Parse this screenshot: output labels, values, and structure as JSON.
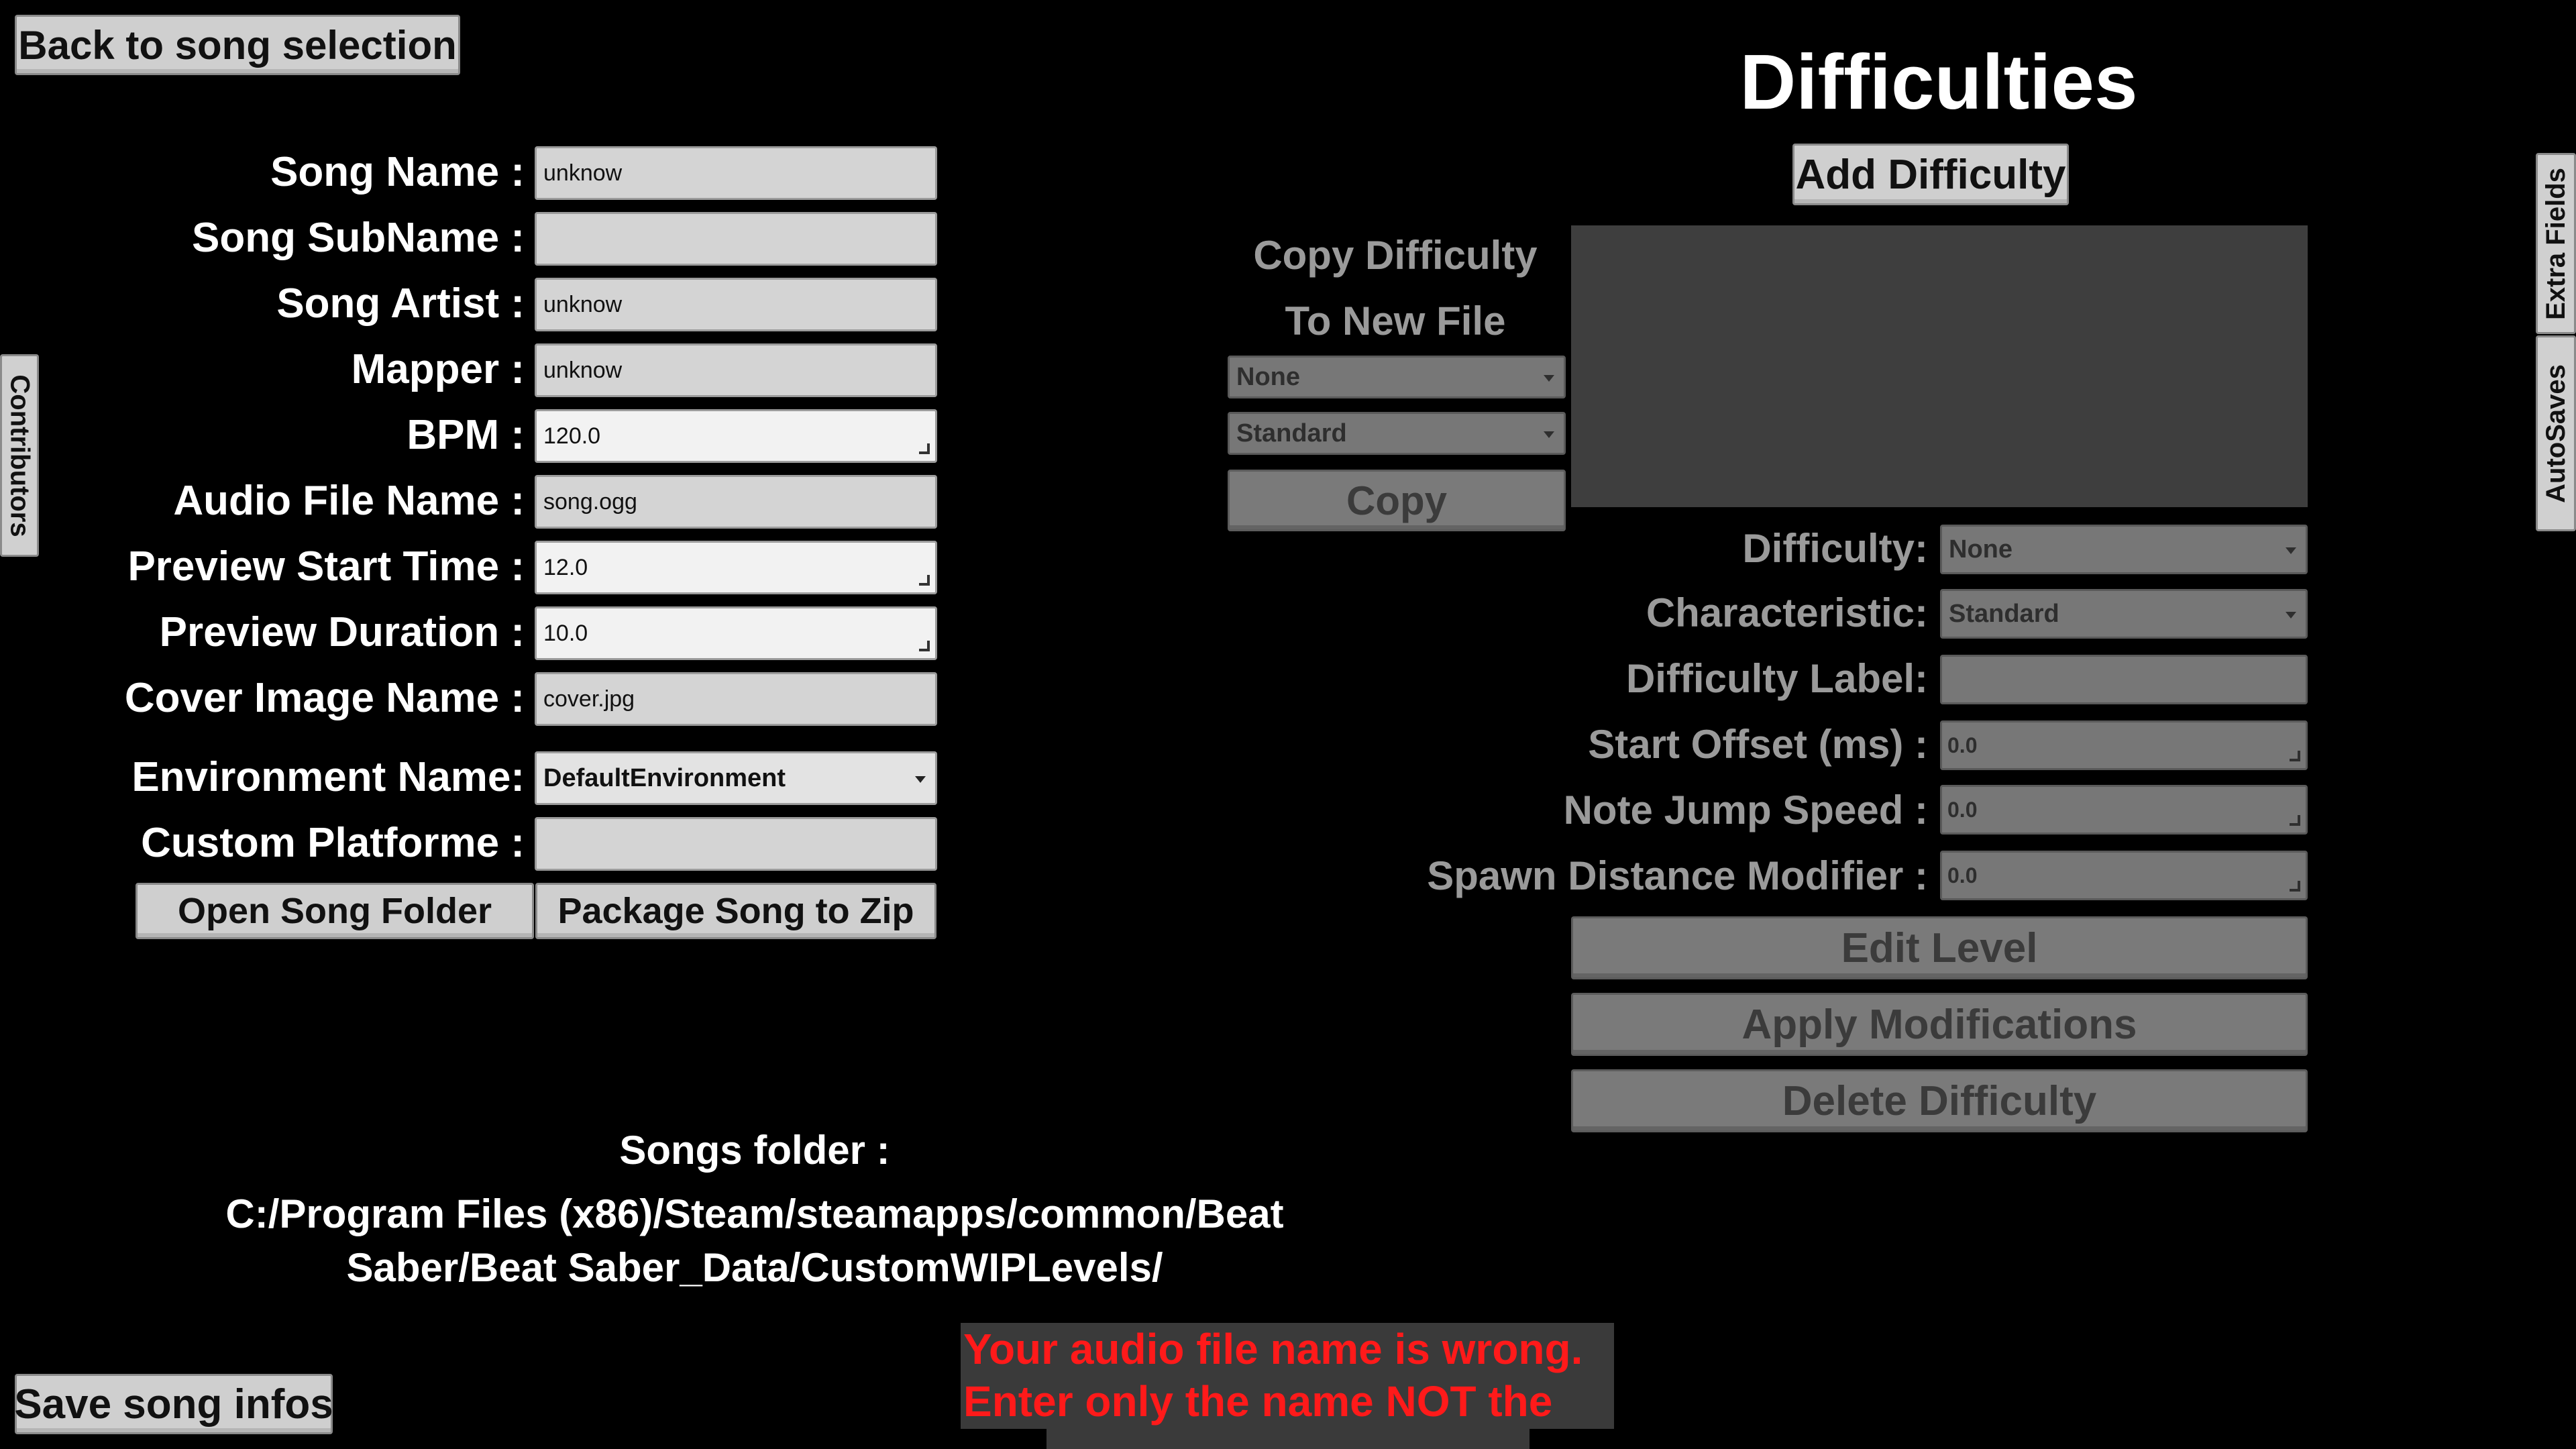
{
  "header": {
    "back_button": "Back to song selection",
    "difficulties_title": "Difficulties",
    "add_difficulty_button": "Add Difficulty"
  },
  "side_tabs": {
    "contributors": "Contributors",
    "extra_fields": "Extra Fields",
    "autosaves": "AutoSaves"
  },
  "song_form": {
    "song_name": {
      "label": "Song Name :",
      "value": "unknow"
    },
    "song_subname": {
      "label": "Song SubName :",
      "value": ""
    },
    "song_artist": {
      "label": "Song Artist :",
      "value": "unknow"
    },
    "mapper": {
      "label": "Mapper :",
      "value": "unknow"
    },
    "bpm": {
      "label": "BPM :",
      "value": "120.0"
    },
    "audio_file_name": {
      "label": "Audio File Name :",
      "value": "song.ogg"
    },
    "preview_start_time": {
      "label": "Preview Start Time :",
      "value": "12.0"
    },
    "preview_duration": {
      "label": "Preview Duration :",
      "value": "10.0"
    },
    "cover_image_name": {
      "label": "Cover Image Name :",
      "value": "cover.jpg"
    },
    "environment_name": {
      "label": "Environment Name:",
      "value": "DefaultEnvironment"
    },
    "custom_platforme": {
      "label": "Custom Platforme :",
      "value": ""
    },
    "open_song_folder_button": "Open Song Folder",
    "package_song_button": "Package Song to Zip"
  },
  "songs_folder": {
    "label": "Songs folder :",
    "path_line1": "C:/Program Files (x86)/Steam/steamapps/common/Beat",
    "path_line2": "Saber/Beat Saber_Data/CustomWIPLevels/"
  },
  "save_button": "Save song infos",
  "error": {
    "line1": "Your audio file name is wrong.",
    "line2": "Enter only the name NOT the path.",
    "color": "#ff1a1a"
  },
  "copy_difficulty": {
    "title_line1": "Copy Difficulty",
    "title_line2": "To New File",
    "difficulty_select": "None",
    "characteristic_select": "Standard",
    "copy_button": "Copy"
  },
  "difficulty_editor": {
    "difficulty": {
      "label": "Difficulty:",
      "value": "None"
    },
    "characteristic": {
      "label": "Characteristic:",
      "value": "Standard"
    },
    "difficulty_label": {
      "label": "Difficulty Label:",
      "value": ""
    },
    "start_offset": {
      "label": "Start Offset (ms) :",
      "value": "0.0"
    },
    "note_jump_speed": {
      "label": "Note Jump Speed :",
      "value": "0.0"
    },
    "spawn_distance_modifier": {
      "label": "Spawn Distance Modifier :",
      "value": "0.0"
    },
    "edit_level_button": "Edit Level",
    "apply_modifications_button": "Apply Modifications",
    "delete_difficulty_button": "Delete Difficulty"
  }
}
